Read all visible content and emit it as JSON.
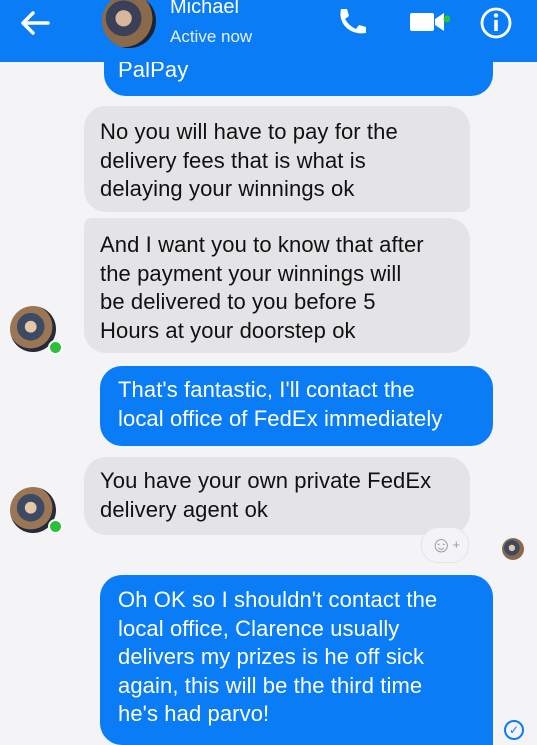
{
  "header": {
    "contact_name": "Michael",
    "status": "Active now"
  },
  "messages": [
    {
      "side": "outgoing",
      "text": "PalPay"
    },
    {
      "side": "incoming",
      "text": "No you will have to pay for the\ndelivery fees that is what is\ndelaying your winnings ok"
    },
    {
      "side": "incoming",
      "text": "And I want you to know that after\nthe payment your winnings will\nbe delivered to you before 5\nHours at your doorstep ok"
    },
    {
      "side": "outgoing",
      "text": "That's fantastic, I'll contact the\nlocal office of FedEx immediately"
    },
    {
      "side": "incoming",
      "text": "You have your own private FedEx\ndelivery agent ok"
    },
    {
      "side": "outgoing",
      "text": "Oh OK so I shouldn't contact the\nlocal office, Clarence usually\ndelivers my prizes is he off sick\nagain, this will be the third time\nhe's had parvo!"
    }
  ],
  "colors": {
    "brand_blue": "#0a7cf5",
    "incoming_bubble": "#e4e4e7",
    "online_green": "#2bc03a"
  },
  "icons": {
    "back": "back-arrow-icon",
    "call": "phone-icon",
    "video": "video-camera-icon",
    "info": "info-icon",
    "react": "add-reaction-icon",
    "sent": "sent-check-icon"
  }
}
